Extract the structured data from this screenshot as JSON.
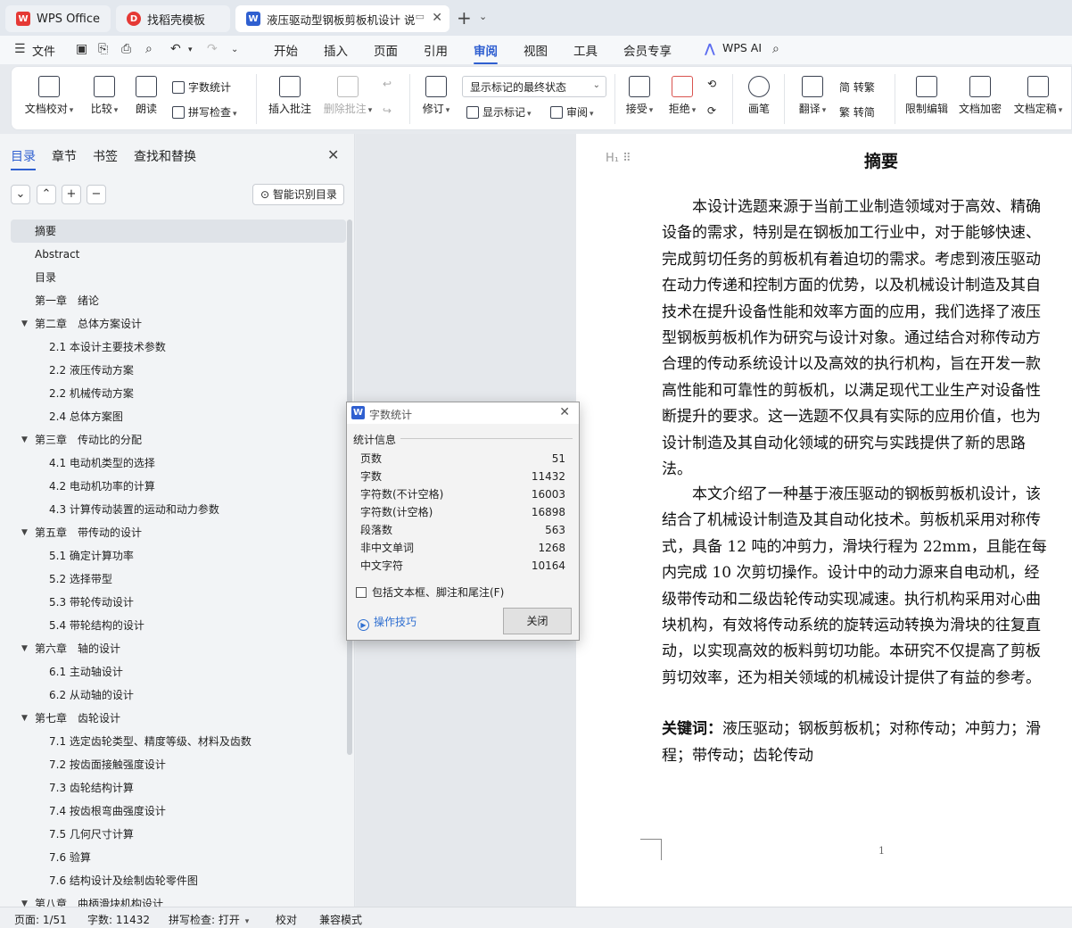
{
  "tabs": [
    {
      "label": "WPS Office",
      "icon": "wps-logo-icon",
      "color": "#e53935"
    },
    {
      "label": "找稻壳模板",
      "icon": "docer-icon",
      "color": "#e53935"
    },
    {
      "label": "液压驱动型钢板剪板机设计 说",
      "icon": "word-doc-icon",
      "color": "#2f5fd0"
    }
  ],
  "menubar": {
    "file_label": "文件",
    "tabs": [
      "开始",
      "插入",
      "页面",
      "引用",
      "审阅",
      "视图",
      "工具",
      "会员专享"
    ],
    "active_tab": "审阅",
    "ai_label": "WPS AI"
  },
  "ribbon": {
    "doc_check": "文档校对",
    "compare": "比较",
    "read_aloud": "朗读",
    "word_count": "字数统计",
    "spell_check": "拼写检查",
    "insert_comment": "插入批注",
    "delete_comment": "删除批注",
    "track": "修订",
    "markup_state": "显示标记的最终状态",
    "show_markup": "显示标记",
    "review_pane": "审阅",
    "accept": "接受",
    "reject": "拒绝",
    "ink": "画笔",
    "translate": "翻译",
    "to_traditional": "简 转繁",
    "to_simplified": "繁 转简",
    "restrict_edit": "限制编辑",
    "encrypt": "文档加密",
    "finalize": "文档定稿"
  },
  "nav": {
    "tabs": [
      "目录",
      "章节",
      "书签",
      "查找和替换"
    ],
    "active": "目录",
    "smart_toc": "智能识别目录",
    "toc": [
      {
        "label": "摘要",
        "level": 1,
        "selected": true
      },
      {
        "label": "Abstract",
        "level": 1
      },
      {
        "label": "目录",
        "level": 1
      },
      {
        "label": "第一章　绪论",
        "level": 1
      },
      {
        "label": "第二章　总体方案设计",
        "level": 1,
        "expanded": true
      },
      {
        "label": "2.1 本设计主要技术参数",
        "level": 2
      },
      {
        "label": "2.2 液压传动方案",
        "level": 2
      },
      {
        "label": "2.2 机械传动方案",
        "level": 2
      },
      {
        "label": "2.4 总体方案图",
        "level": 2
      },
      {
        "label": "第三章　传动比的分配",
        "level": 1,
        "expanded": true
      },
      {
        "label": "4.1 电动机类型的选择",
        "level": 2
      },
      {
        "label": "4.2 电动机功率的计算",
        "level": 2
      },
      {
        "label": "4.3 计算传动装置的运动和动力参数",
        "level": 2
      },
      {
        "label": "第五章　带传动的设计",
        "level": 1,
        "expanded": true
      },
      {
        "label": "5.1 确定计算功率",
        "level": 2
      },
      {
        "label": "5.2 选择带型",
        "level": 2
      },
      {
        "label": "5.3 带轮传动设计",
        "level": 2
      },
      {
        "label": "5.4 带轮结构的设计",
        "level": 2
      },
      {
        "label": "第六章　轴的设计",
        "level": 1,
        "expanded": true
      },
      {
        "label": "6.1 主动轴设计",
        "level": 2
      },
      {
        "label": "6.2 从动轴的设计",
        "level": 2
      },
      {
        "label": "第七章　齿轮设计",
        "level": 1,
        "expanded": true
      },
      {
        "label": "7.1 选定齿轮类型、精度等级、材料及齿数",
        "level": 2
      },
      {
        "label": "7.2 按齿面接触强度设计",
        "level": 2
      },
      {
        "label": "7.3 齿轮结构计算",
        "level": 2
      },
      {
        "label": "7.4 按齿根弯曲强度设计",
        "level": 2
      },
      {
        "label": "7.5 几何尺寸计算",
        "level": 2
      },
      {
        "label": "7.6 验算",
        "level": 2
      },
      {
        "label": "7.6 结构设计及绘制齿轮零件图",
        "level": 2
      },
      {
        "label": "第八章　曲柄滑块机构设计",
        "level": 1,
        "expanded": true
      }
    ]
  },
  "document": {
    "title": "摘要",
    "page_number": "1",
    "para1": [
      "　　本设计选题来源于当前工业制造领域对于高效、精确",
      "设备的需求，特别是在钢板加工行业中，对于能够快速、",
      "完成剪切任务的剪板机有着迫切的需求。考虑到液压驱动",
      "在动力传递和控制方面的优势，以及机械设计制造及其自",
      "技术在提升设备性能和效率方面的应用，我们选择了液压",
      "型钢板剪板机作为研究与设计对象。通过结合对称传动方",
      "合理的传动系统设计以及高效的执行机构，旨在开发一款",
      "高性能和可靠性的剪板机，以满足现代工业生产对设备性",
      "断提升的要求。这一选题不仅具有实际的应用价值，也为",
      "设计制造及其自动化领域的研究与实践提供了新的思路",
      "法。"
    ],
    "para2": [
      "　　本文介绍了一种基于液压驱动的钢板剪板机设计，该",
      "结合了机械设计制造及其自动化技术。剪板机采用对称传",
      "式，具备 12 吨的冲剪力，滑块行程为 22mm，且能在每",
      "内完成 10 次剪切操作。设计中的动力源来自电动机，经",
      "级带传动和二级齿轮传动实现减速。执行机构采用对心曲",
      "块机构，有效将传动系统的旋转运动转换为滑块的往复直",
      "动，以实现高效的板料剪切功能。本研究不仅提高了剪板",
      "剪切效率，还为相关领域的机械设计提供了有益的参考。"
    ],
    "keywords_label": "关键词：",
    "keywords_line1": "液压驱动；钢板剪板机；对称传动；冲剪力；滑",
    "keywords_line2": "程；带传动；齿轮传动"
  },
  "dialog": {
    "title": "字数统计",
    "section": "统计信息",
    "rows": [
      {
        "label": "页数",
        "value": "51"
      },
      {
        "label": "字数",
        "value": "11432"
      },
      {
        "label": "字符数(不计空格)",
        "value": "16003"
      },
      {
        "label": "字符数(计空格)",
        "value": "16898"
      },
      {
        "label": "段落数",
        "value": "563"
      },
      {
        "label": "非中文单词",
        "value": "1268"
      },
      {
        "label": "中文字符",
        "value": "10164"
      }
    ],
    "checkbox_label": "包括文本框、脚注和尾注(F)",
    "checkbox_checked": false,
    "tips_link": "操作技巧",
    "close_button": "关闭"
  },
  "statusbar": {
    "page": "页面: 1/51",
    "words": "字数: 11432",
    "spell": "拼写检查: 打开",
    "proof": "校对",
    "compat": "兼容模式"
  },
  "colors": {
    "accent": "#2f5fd0",
    "wps_red": "#e53935"
  }
}
